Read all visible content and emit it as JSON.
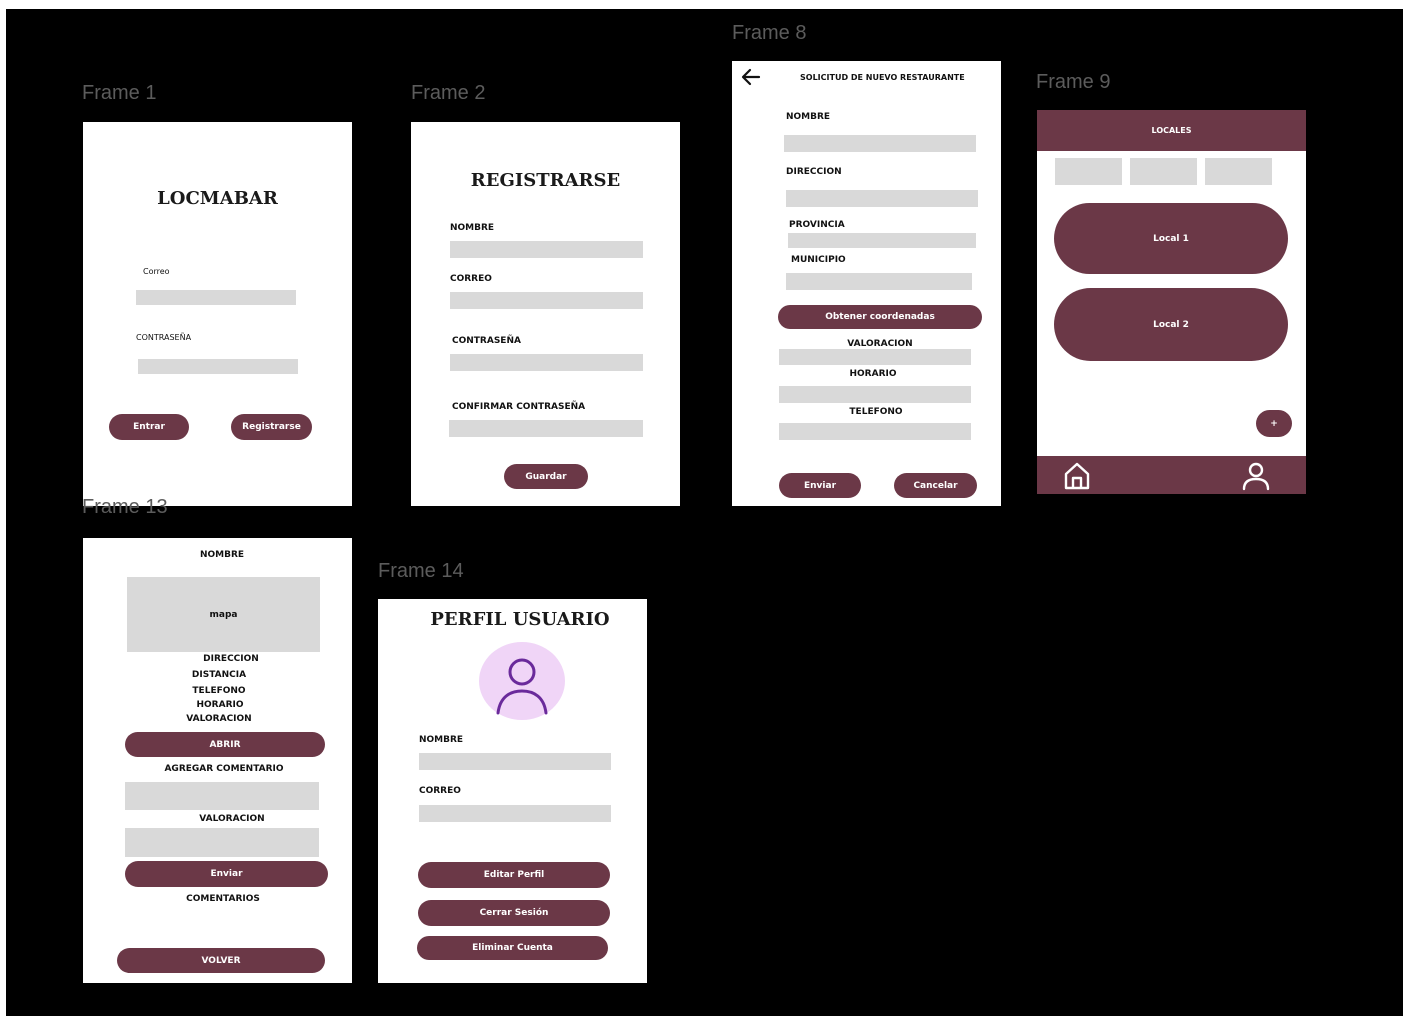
{
  "frames": {
    "f1": {
      "name": "Frame 1",
      "title": "LOCMABAR",
      "email_label": "Correo",
      "password_label": "CONTRASEÑA",
      "enter_label": "Entrar",
      "register_label": "Registrarse"
    },
    "f2": {
      "name": "Frame 2",
      "title": "REGISTRARSE",
      "name_label": "NOMBRE",
      "email_label": "CORREO",
      "password_label": "CONTRASEÑA",
      "confirm_label": "CONFIRMAR CONTRASEÑA",
      "save_label": "Guardar"
    },
    "f8": {
      "name": "Frame 8",
      "back_icon": "arrow-left-icon",
      "title": "SOLICITUD DE NUEVO RESTAURANTE",
      "name_label": "NOMBRE",
      "address_label": "DIRECCION",
      "province_label": "PROVINCIA",
      "municipality_label": "MUNICIPIO",
      "coords_label": "Obtener coordenadas",
      "rating_label": "VALORACION",
      "schedule_label": "HORARIO",
      "phone_label": "TELEFONO",
      "send_label": "Enviar",
      "cancel_label": "Cancelar"
    },
    "f9": {
      "name": "Frame 9",
      "header": "LOCALES",
      "items": [
        "Local 1",
        "Local 2"
      ],
      "add_label": "+",
      "home_icon": "home-icon",
      "user_icon": "user-icon"
    },
    "f13": {
      "name": "Frame 13",
      "name_label": "NOMBRE",
      "map_label": "mapa",
      "address_label": "DIRECCION",
      "distance_label": "DISTANCIA",
      "phone_label": "TELEFONO",
      "schedule_label": "HORARIO",
      "rating_label": "VALORACION",
      "open_label": "ABRIR",
      "add_comment_label": "AGREGAR COMENTARIO",
      "rating_input_label": "VALORACION",
      "send_label": "Enviar",
      "comments_label": "COMENTARIOS",
      "back_label": "VOLVER"
    },
    "f14": {
      "name": "Frame 14",
      "title": "PERFIL USUARIO",
      "avatar_icon": "user-avatar-icon",
      "name_label": "NOMBRE",
      "email_label": "CORREO",
      "edit_label": "Editar Perfil",
      "logout_label": "Cerrar Sesión",
      "delete_label": "Eliminar Cuenta"
    }
  },
  "colors": {
    "accent": "#6b3847",
    "canvas": "#000000",
    "field": "#d9d9d9",
    "frame_label": "#5c5c5c",
    "avatar_bg": "#f0d5f7",
    "avatar_stroke": "#6a2a9b"
  }
}
